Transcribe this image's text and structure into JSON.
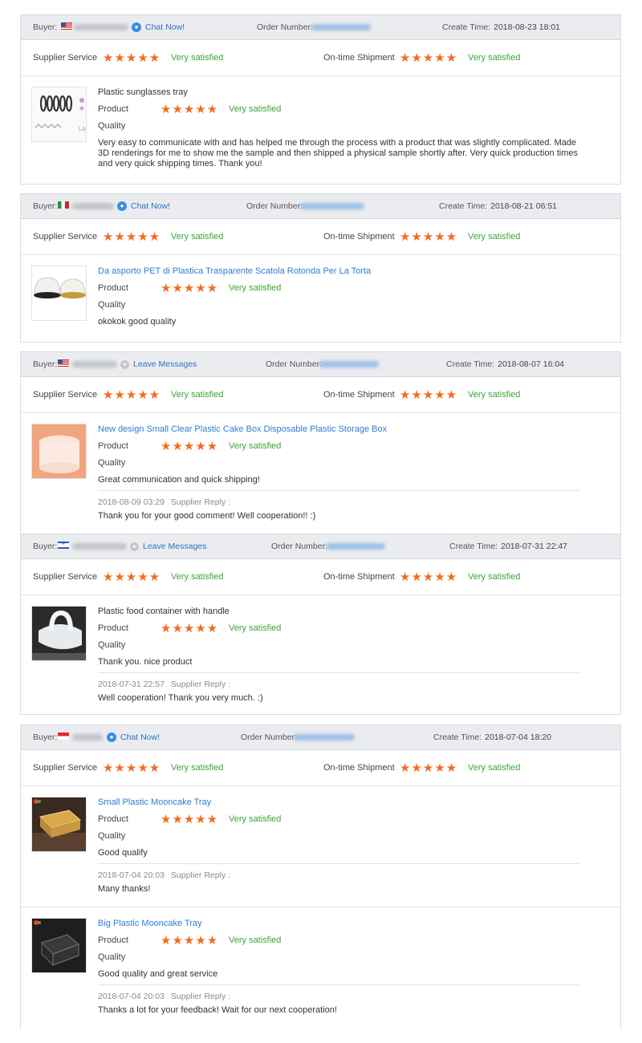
{
  "labels": {
    "buyer": "Buyer:",
    "order_number": "Order Number:",
    "create_time": "Create Time:",
    "supplier_service": "Supplier Service",
    "ontime_shipment": "On-time Shipment",
    "very_satisfied": "Very satisfied",
    "product": "Product",
    "quality": "Quality",
    "supplier_reply": "Supplier Reply :"
  },
  "star_rating": 5,
  "colors": {
    "star": "#f26c1e",
    "satisfied": "#3aa536",
    "link": "#2f7dcd",
    "header_bg": "#ebecef"
  },
  "reviews": [
    {
      "flag": "US",
      "contact_label": "Chat Now!",
      "contact_icon": "chat-icon",
      "create_time": "2018-08-23 18:01",
      "products": [
        {
          "title": "Plastic sunglasses tray",
          "comment": "Very easy to communicate with and has helped me through the process with a product that was slightly complicated. Made 3D renderings for me to show me the sample and then shipped a physical sample shortly after. Very quick production times and very quick shipping times. Thank you!"
        }
      ]
    },
    {
      "flag": "IT",
      "contact_label": "Chat Now!",
      "contact_icon": "chat-icon",
      "create_time": "2018-08-21 06:51",
      "products": [
        {
          "title": "Da asporto PET di Plastica Trasparente Scatola Rotonda Per La Torta",
          "comment": "okokok good quality"
        }
      ]
    },
    {
      "flag": "US",
      "contact_label": "Leave Messages",
      "contact_icon": "message-icon",
      "create_time": "2018-08-07 16:04",
      "products": [
        {
          "title": "New design Small Clear Plastic Cake Box Disposable Plastic Storage Box",
          "comment": "Great communication and quick shipping!",
          "reply_time": "2018-08-09 03:29",
          "reply": "Thank you for your good comment! Well cooperation!! :)"
        }
      ]
    },
    {
      "flag": "IL",
      "contact_label": "Leave Messages",
      "contact_icon": "message-icon",
      "create_time": "2018-07-31 22:47",
      "products": [
        {
          "title": "Plastic food container with handle",
          "comment": "Thank you. nice product",
          "reply_time": "2018-07-31 22:57",
          "reply": "Well cooperation! Thank you very much. :)"
        }
      ]
    },
    {
      "flag": "SG",
      "contact_label": "Chat Now!",
      "contact_icon": "chat-icon",
      "create_time": "2018-07-04 18:20",
      "products": [
        {
          "title": "Small Plastic Mooncake Tray",
          "comment": "Good qualify",
          "reply_time": "2018-07-04 20:03",
          "reply": "Many thanks!"
        },
        {
          "title": "Big Plastic Mooncake Tray",
          "comment": "Good quality and great service",
          "reply_time": "2018-07-04 20:03",
          "reply": "Thanks a lot for your feedback! Wait for our next cooperation!"
        }
      ]
    }
  ]
}
